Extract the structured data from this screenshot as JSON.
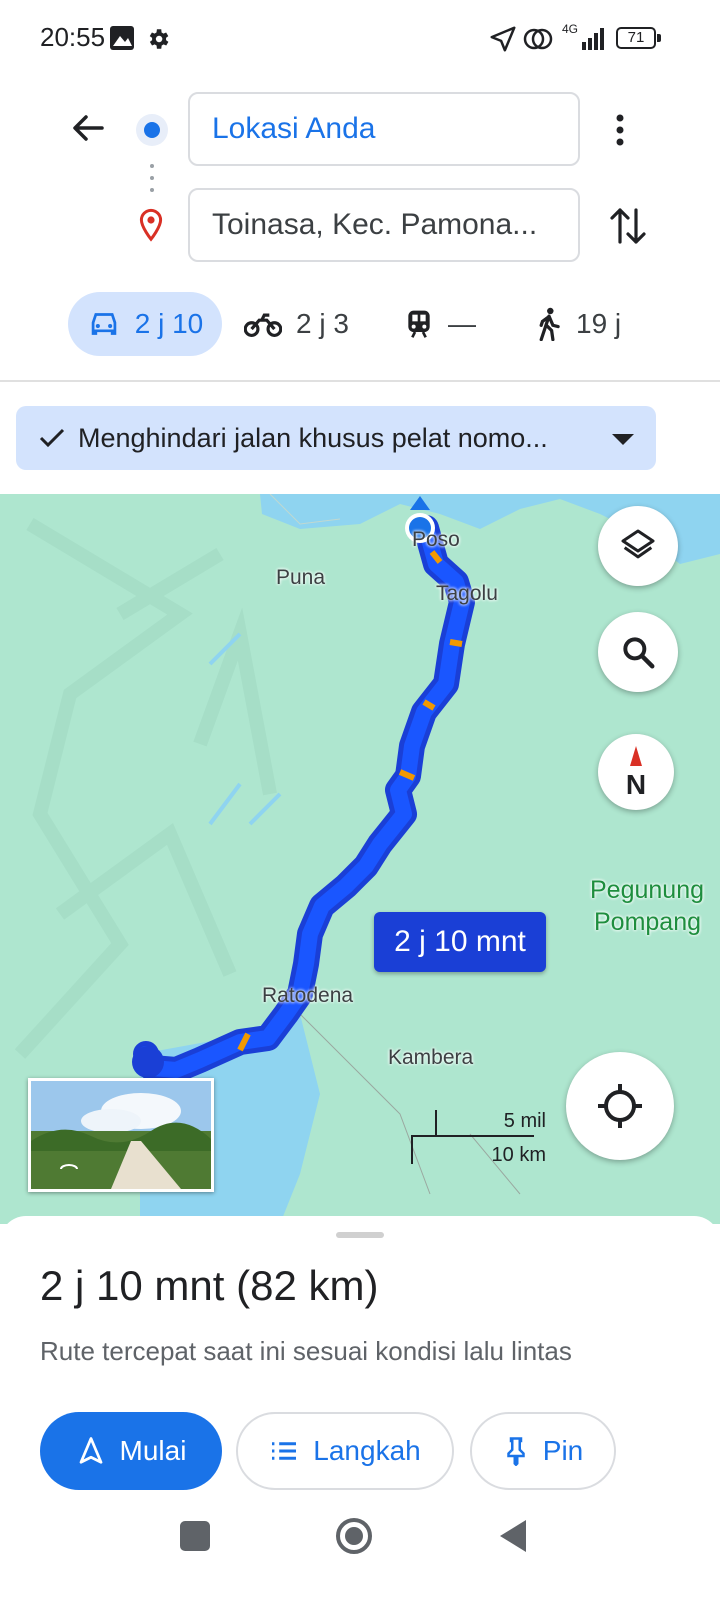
{
  "status_bar": {
    "time": "20:55",
    "network": "4G",
    "battery": "71",
    "icons": [
      "gallery-icon",
      "settings-icon",
      "location-arrow-icon",
      "hotspot-icon",
      "signal-icon",
      "battery-icon"
    ]
  },
  "directions": {
    "origin": "Lokasi Anda",
    "destination": "Toinasa, Kec. Pamona...",
    "modes": [
      {
        "name": "car",
        "label": "2 j 10",
        "active": true
      },
      {
        "name": "motorcycle",
        "label": "2 j 3"
      },
      {
        "name": "transit",
        "label": "—"
      },
      {
        "name": "walk",
        "label": "19 j"
      }
    ]
  },
  "filter_chip": {
    "label": "Menghindari jalan khusus pelat nomo..."
  },
  "map": {
    "places": [
      "Poso",
      "Puna",
      "Tagolu",
      "Ratodena",
      "Kambera"
    ],
    "region_label": [
      "Pegunung",
      "Pompang"
    ],
    "route_label": "2 j 10 mnt",
    "scale": {
      "miles": "5 mil",
      "km": "10 km"
    },
    "route_color": "#1a3fd6",
    "land_color": "#aee6cf",
    "water_color": "#8fd4f0"
  },
  "sheet": {
    "summary": "2 j 10 mnt (82 km)",
    "subtitle": "Rute tercepat saat ini sesuai kondisi lalu lintas",
    "buttons": {
      "start": "Mulai",
      "steps": "Langkah",
      "pin": "Pin"
    }
  }
}
